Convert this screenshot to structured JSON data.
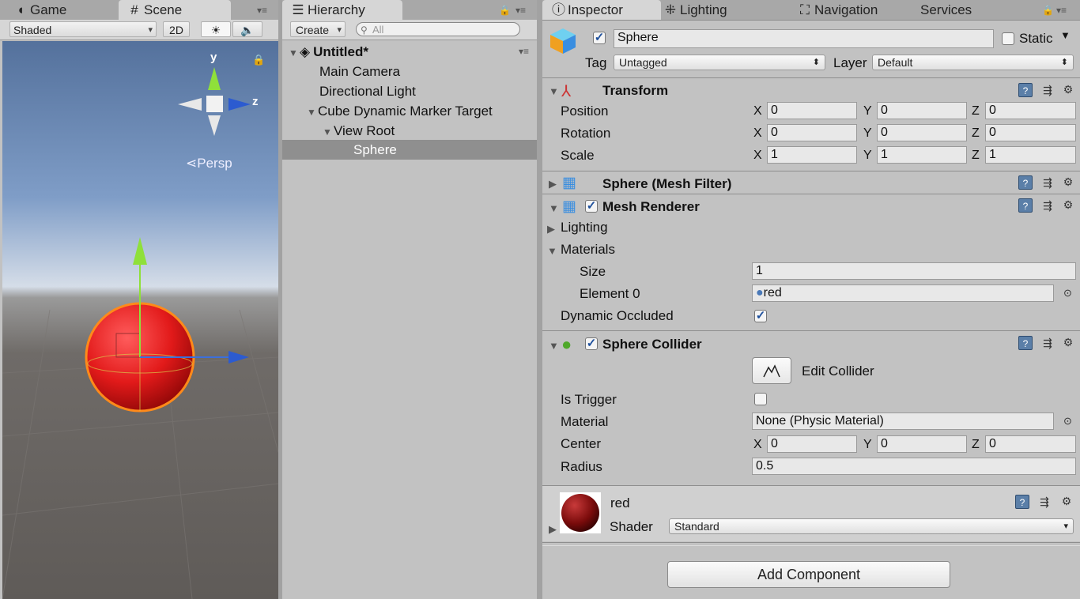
{
  "scene_panel": {
    "tabs": [
      {
        "label": "Game"
      },
      {
        "label": "Scene"
      }
    ],
    "toolbar": {
      "shading_mode": "Shaded",
      "mode_2d": "2D"
    },
    "gizmo": {
      "y": "y",
      "z": "z",
      "persp": "Persp"
    }
  },
  "hierarchy": {
    "tab_label": "Hierarchy",
    "create_label": "Create",
    "search_placeholder": "All",
    "items": [
      {
        "label": "Untitled*"
      },
      {
        "label": "Main Camera"
      },
      {
        "label": "Directional Light"
      },
      {
        "label": "Cube Dynamic Marker Target"
      },
      {
        "label": "View Root"
      },
      {
        "label": "Sphere"
      }
    ]
  },
  "inspector": {
    "tabs": [
      {
        "label": "Inspector"
      },
      {
        "label": "Lighting"
      },
      {
        "label": "Navigation"
      },
      {
        "label": "Services"
      }
    ],
    "object_name": "Sphere",
    "static_label": "Static",
    "tag_label": "Tag",
    "tag_value": "Untagged",
    "layer_label": "Layer",
    "layer_value": "Default",
    "transform": {
      "title": "Transform",
      "position_label": "Position",
      "rotation_label": "Rotation",
      "scale_label": "Scale",
      "axis_x": "X",
      "axis_y": "Y",
      "axis_z": "Z",
      "position": [
        "0",
        "0",
        "0"
      ],
      "rotation": [
        "0",
        "0",
        "0"
      ],
      "scale": [
        "1",
        "1",
        "1"
      ]
    },
    "mesh_filter": {
      "title": "Sphere (Mesh Filter)"
    },
    "mesh_renderer": {
      "title": "Mesh Renderer",
      "lighting_label": "Lighting",
      "materials_label": "Materials",
      "size_label": "Size",
      "size_value": "1",
      "element0_label": "Element 0",
      "element0_value": "red",
      "dynamic_occluded_label": "Dynamic Occluded"
    },
    "sphere_collider": {
      "title": "Sphere Collider",
      "edit_collider_label": "Edit Collider",
      "is_trigger_label": "Is Trigger",
      "material_label": "Material",
      "material_value": "None (Physic Material)",
      "center_label": "Center",
      "center": [
        "0",
        "0",
        "0"
      ],
      "radius_label": "Radius",
      "radius_value": "0.5"
    },
    "material": {
      "name": "red",
      "shader_label": "Shader",
      "shader_value": "Standard"
    },
    "add_component_label": "Add Component"
  }
}
